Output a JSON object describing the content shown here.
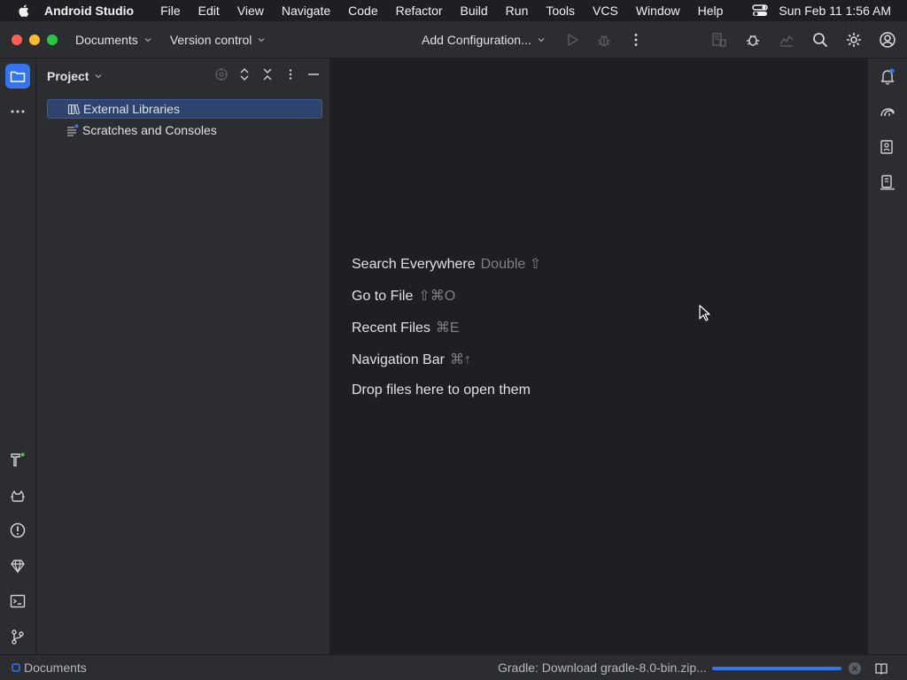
{
  "menubar": {
    "app_name": "Android Studio",
    "items": [
      "File",
      "Edit",
      "View",
      "Navigate",
      "Code",
      "Refactor",
      "Build",
      "Run",
      "Tools",
      "VCS",
      "Window",
      "Help"
    ],
    "clock": "Sun Feb 11  1:56 AM"
  },
  "toolbar": {
    "project_selector": "Documents",
    "vcs_selector": "Version control",
    "run_config": "Add Configuration..."
  },
  "project_panel": {
    "title": "Project",
    "tree": [
      {
        "label": "External Libraries",
        "icon": "library-icon",
        "selected": true
      },
      {
        "label": "Scratches and Consoles",
        "icon": "scratches-icon",
        "selected": false
      }
    ]
  },
  "editor": {
    "hints": [
      {
        "label": "Search Everywhere",
        "shortcut": "Double ⇧"
      },
      {
        "label": "Go to File",
        "shortcut": "⇧⌘O"
      },
      {
        "label": "Recent Files",
        "shortcut": "⌘E"
      },
      {
        "label": "Navigation Bar",
        "shortcut": "⌘↑"
      },
      {
        "label": "Drop files here to open them",
        "shortcut": ""
      }
    ]
  },
  "statusbar": {
    "breadcrumb": "Documents",
    "progress_text": "Gradle: Download gradle-8.0-bin.zip...",
    "progress_fraction": 1.0
  },
  "colors": {
    "accent": "#3574f0",
    "close": "#ff5f57",
    "minimize": "#febc2e",
    "zoom": "#28c840"
  }
}
